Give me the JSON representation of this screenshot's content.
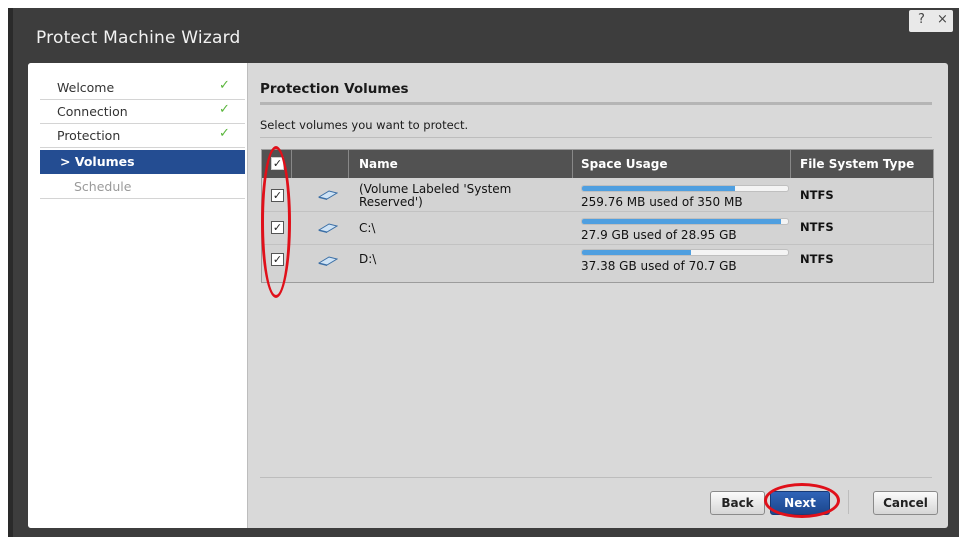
{
  "window": {
    "title": "Protect Machine Wizard",
    "help_label": "?",
    "close_label": "×"
  },
  "sidebar": {
    "items": [
      {
        "label": "Welcome",
        "done": true
      },
      {
        "label": "Connection",
        "done": true
      },
      {
        "label": "Protection",
        "done": true
      },
      {
        "label": "> Volumes",
        "active": true
      },
      {
        "label": "Schedule",
        "disabled": true
      }
    ],
    "check_glyph": "✓"
  },
  "page": {
    "heading": "Protection Volumes",
    "instruction": "Select volumes you want to protect."
  },
  "grid": {
    "columns": [
      "Name",
      "Space Usage",
      "File System Type"
    ],
    "select_all_checked": true,
    "rows": [
      {
        "checked": true,
        "icon": "drive-icon",
        "name": "(Volume Labeled 'System Reserved')",
        "usage": "259.76 MB used of 350 MB",
        "used_fraction": 0.742,
        "fs": "NTFS"
      },
      {
        "checked": true,
        "icon": "drive-icon",
        "name": "C:\\",
        "usage": "27.9 GB used of 28.95 GB",
        "used_fraction": 0.964,
        "fs": "NTFS"
      },
      {
        "checked": true,
        "icon": "drive-icon",
        "name": "D:\\",
        "usage": "37.38 GB used of 70.7 GB",
        "used_fraction": 0.529,
        "fs": "NTFS"
      }
    ]
  },
  "buttons": {
    "back": "Back",
    "next": "Next",
    "cancel": "Cancel"
  },
  "colors": {
    "accent": "#244d92",
    "check": "#5ab63c",
    "bar": "#4f9fe0",
    "annotation": "#e0101a"
  }
}
